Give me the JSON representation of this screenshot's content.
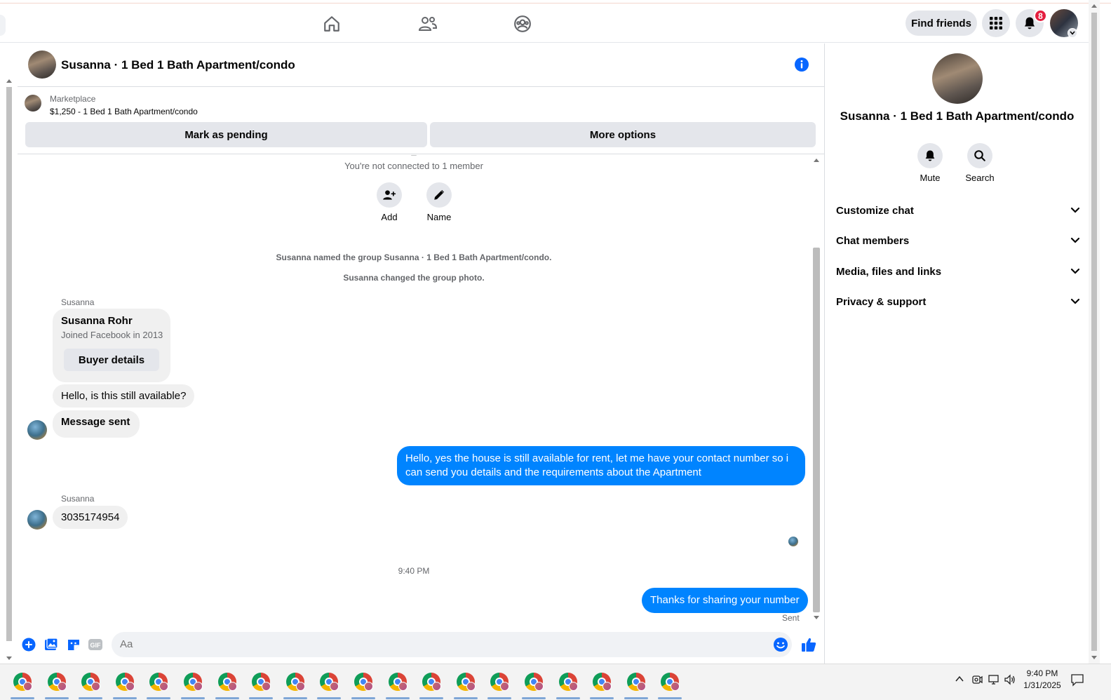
{
  "topnav": {
    "find_friends": "Find friends",
    "notification_count": "8"
  },
  "chat": {
    "title": "Susanna · 1 Bed 1 Bath Apartment/condo",
    "marketplace_source": "Marketplace",
    "listing": "$1,250 - 1 Bed 1 Bath Apartment/condo",
    "mark_pending": "Mark as pending",
    "more_options": "More options",
    "not_connected": "You're not connected to 1 member",
    "action_add": "Add",
    "action_name": "Name",
    "event_named": "Susanna named the group Susanna · 1 Bed 1 Bath Apartment/condo.",
    "event_photo": "Susanna changed the group photo.",
    "sender1": "Susanna",
    "card_name": "Susanna Rohr",
    "card_joined": "Joined Facebook in 2013",
    "card_button": "Buyer details",
    "msg1": "Hello, is this still available?",
    "msg2": "Message sent",
    "reply1": "Hello, yes the house is still available for rent, let me have your contact number so i can send you details and the requirements about the  Apartment",
    "sender2": "Susanna",
    "msg3": "3035174954",
    "timestamp": "9:40 PM",
    "reply2": "Thanks for sharing your number",
    "sent_status": "Sent",
    "composer_placeholder": "Aa"
  },
  "right_panel": {
    "title": "Susanna · 1 Bed 1 Bath Apartment/condo",
    "mute": "Mute",
    "search": "Search",
    "sections": [
      "Customize chat",
      "Chat members",
      "Media, files and links",
      "Privacy & support"
    ]
  },
  "taskbar": {
    "time": "9:40 PM",
    "date": "1/31/2025"
  },
  "colors": {
    "accent": "#0084ff",
    "badge": "#e41e3f"
  }
}
